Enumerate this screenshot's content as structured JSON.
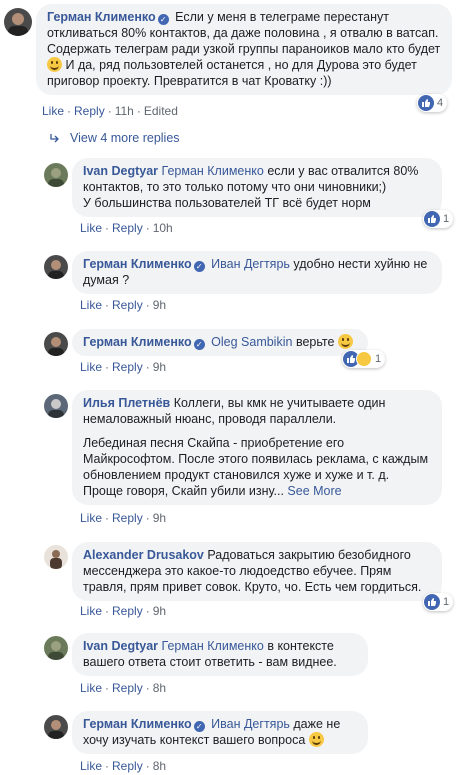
{
  "colors": {
    "link": "#385898",
    "bubble": "#f2f3f5",
    "meta": "#606770",
    "like": "#4267b2"
  },
  "comments": [
    {
      "author": "Герман Клименко",
      "verified": true,
      "text": "Если у меня в телеграме перестанут откливаться 80% контактов, да даже половина , я отвалю в ватсап. Содержать телеграм ради узкой группы параноиков мало кто будет",
      "text2": "И да, ряд пользовтелей останется , но для Дурова это будет приговор проекту. Превратится в чат Кроватку :))",
      "like": "Like",
      "reply": "Reply",
      "time": "11h",
      "edited": "Edited",
      "reactions": "4"
    },
    {
      "author": "Ivan Degtyar",
      "mention": "Герман Клименко",
      "text": "если у вас отвалится 80% контактов, то это только потому что они чиновники;)",
      "text2": "У большинства пользователей ТГ всё будет норм",
      "like": "Like",
      "reply": "Reply",
      "time": "10h",
      "reactions": "1"
    },
    {
      "author": "Герман Клименко",
      "verified": true,
      "mention": "Иван Дегтярь",
      "text": "удобно нести хуйню не думая ?",
      "like": "Like",
      "reply": "Reply",
      "time": "9h"
    },
    {
      "author": "Герман Клименко",
      "verified": true,
      "mention": "Oleg Sambikin",
      "text": "верьте",
      "like": "Like",
      "reply": "Reply",
      "time": "9h",
      "reactions": "1"
    },
    {
      "author": "Илья Плетнёв",
      "text": "Коллеги, вы кмк не учитываете один немаловажный нюанс, проводя параллели.",
      "text2": "Лебединая песня Скайпа - приобретение его Майкрософтом. После этого появилась реклама, с каждым обновлением продукт становился хуже и хуже и т. д. Проще говоря, Скайп убили изну...",
      "see_more": "See More",
      "like": "Like",
      "reply": "Reply",
      "time": "9h"
    },
    {
      "author": "Alexander Drusakov",
      "text": "Радоваться закрытию безобидного мессенджера это какое-то людоедство ебучее. Прям травля, прям привет совок. Круто, чо. Есть чем гордиться.",
      "like": "Like",
      "reply": "Reply",
      "time": "9h",
      "reactions": "1"
    },
    {
      "author": "Ivan Degtyar",
      "mention": "Герман Клименко",
      "text": "в контексте вашего ответа стоит ответить - вам виднее.",
      "like": "Like",
      "reply": "Reply",
      "time": "8h"
    },
    {
      "author": "Герман Клименко",
      "verified": true,
      "mention": "Иван Дегтярь",
      "text": "даже не хочу изучать контекст вашего вопроса",
      "like": "Like",
      "reply": "Reply",
      "time": "8h"
    }
  ],
  "view_more": "View 4 more replies",
  "separator": "·"
}
